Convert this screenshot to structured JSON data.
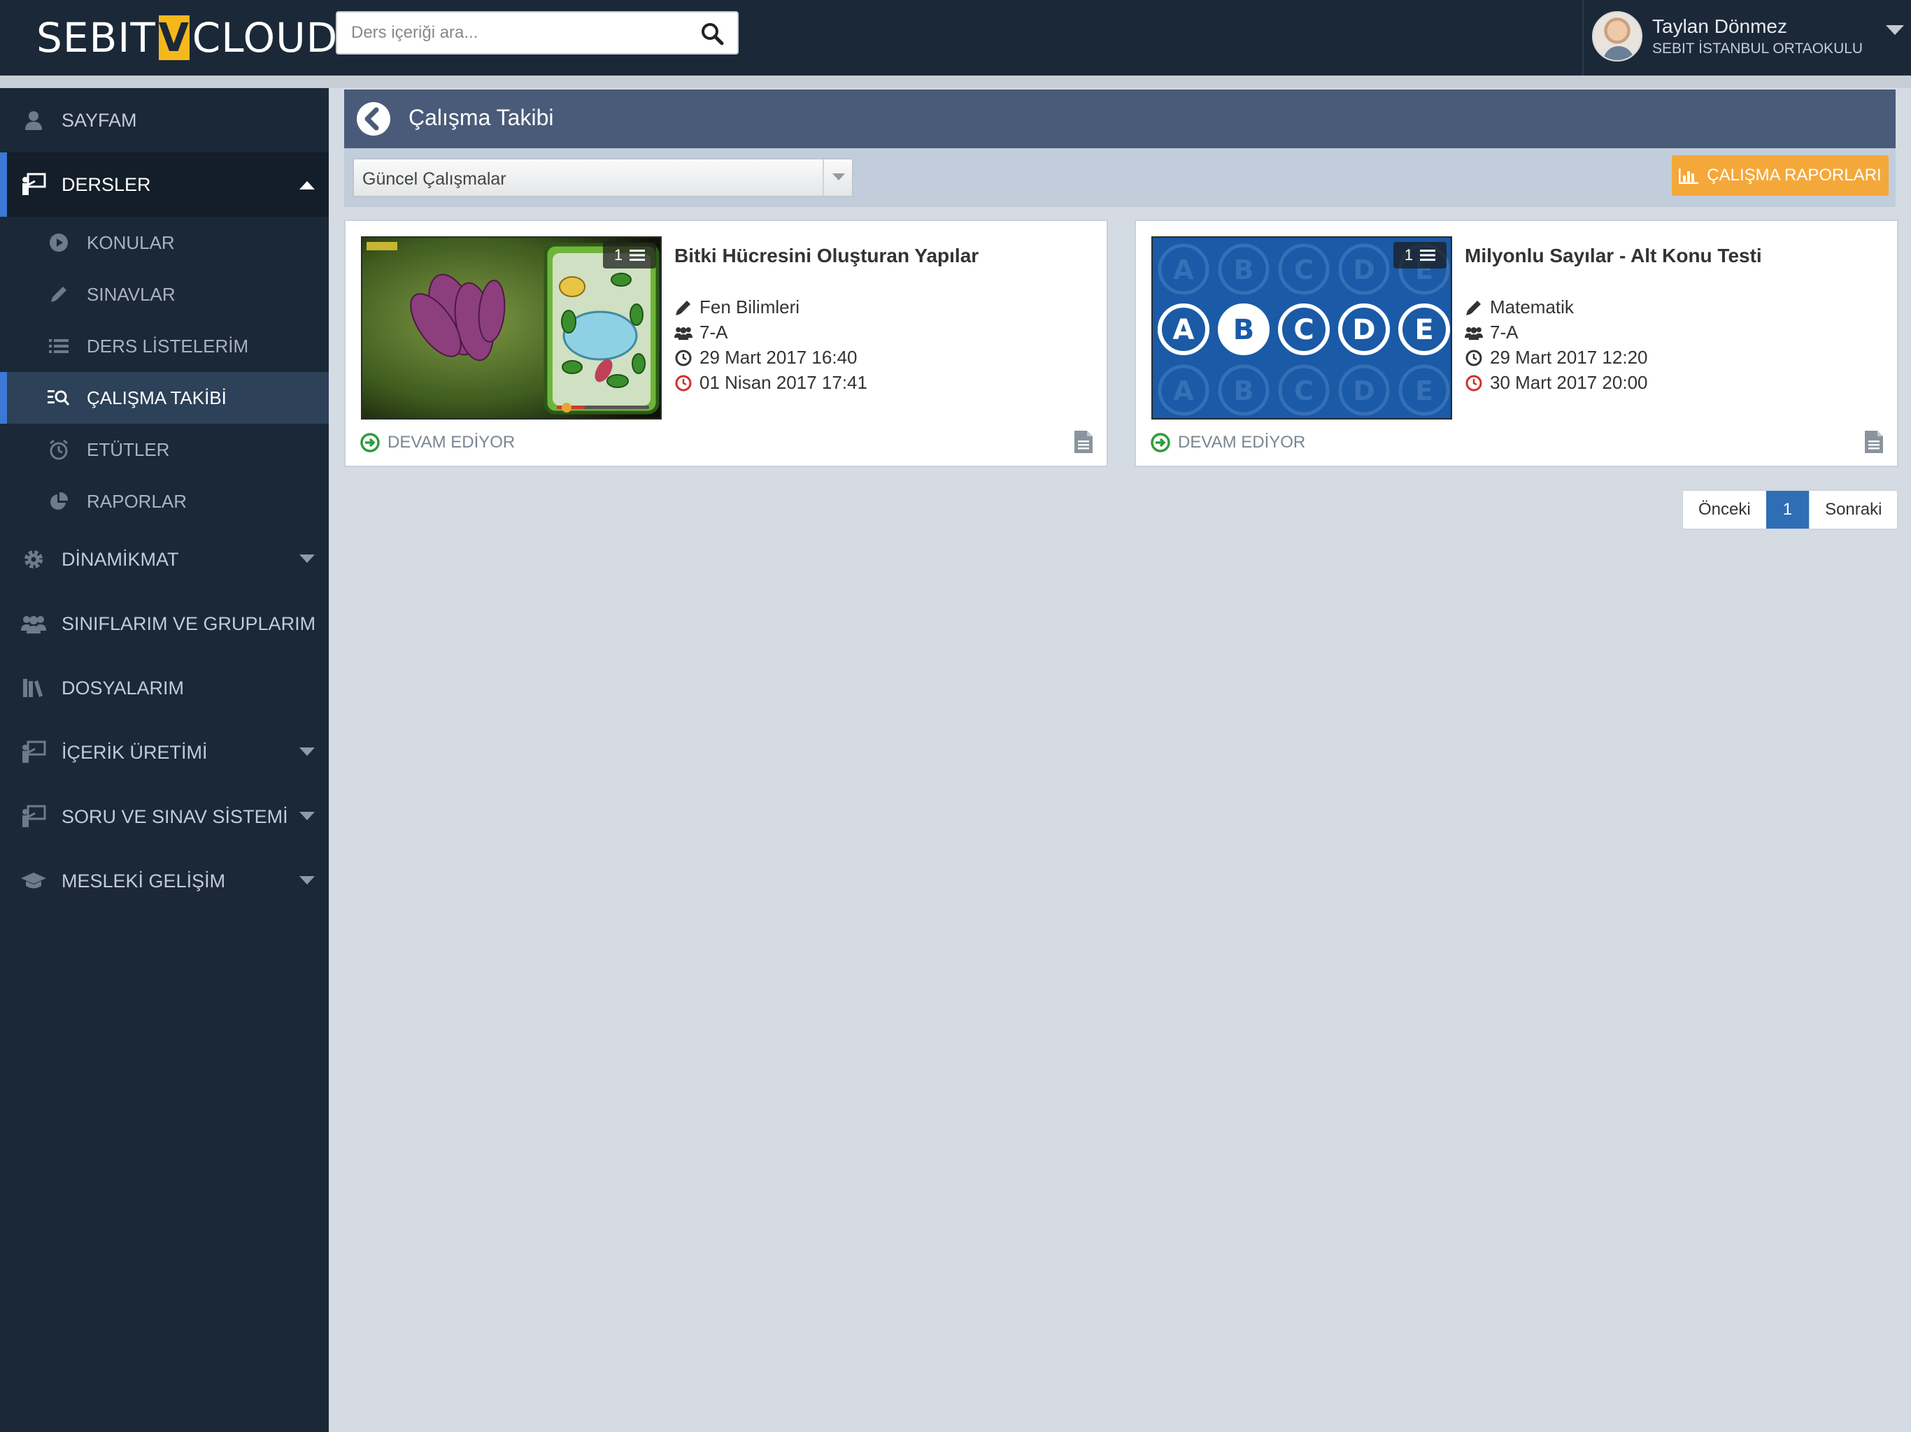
{
  "header": {
    "logo_left": "SEBIT",
    "logo_mark": "V",
    "logo_right": "CLOUD",
    "search_placeholder": "Ders içeriği ara...",
    "user_name": "Taylan Dönmez",
    "user_school": "SEBIT İSTANBUL ORTAOKULU"
  },
  "sidebar": {
    "items": [
      {
        "label": "SAYFAM",
        "icon": "user-icon"
      },
      {
        "label": "DERSLER",
        "icon": "teacher-board-icon"
      },
      {
        "label": "DİNAMİKMAT",
        "icon": "gear-icon"
      },
      {
        "label": "SINIFLARIM VE GRUPLARIM",
        "icon": "users-icon"
      },
      {
        "label": "DOSYALARIM",
        "icon": "library-icon"
      },
      {
        "label": "İÇERİK ÜRETİMİ",
        "icon": "teacher-board-icon"
      },
      {
        "label": "SORU VE SINAV SİSTEMİ",
        "icon": "teacher-board-icon"
      },
      {
        "label": "MESLEKİ GELİŞİM",
        "icon": "graduation-cap-icon"
      }
    ],
    "subitems": [
      {
        "label": "KONULAR",
        "icon": "play-circle-icon"
      },
      {
        "label": "SINAVLAR",
        "icon": "pencil-icon"
      },
      {
        "label": "DERS LİSTELERİM",
        "icon": "list-icon"
      },
      {
        "label": "ÇALIŞMA TAKİBİ",
        "icon": "search-list-icon"
      },
      {
        "label": "ETÜTLER",
        "icon": "alarm-clock-icon"
      },
      {
        "label": "RAPORLAR",
        "icon": "pie-chart-icon"
      }
    ]
  },
  "main": {
    "title": "Çalışma Takibi",
    "filter_value": "Güncel Çalışmalar",
    "reports_button": "ÇALIŞMA RAPORLARI",
    "cards": [
      {
        "title": "Bitki Hücresini Oluşturan Yapılar",
        "count": "1",
        "subject": "Fen Bilimleri",
        "class": "7-A",
        "start": "29 Mart 2017 16:40",
        "end": "01 Nisan 2017 17:41",
        "status": "DEVAM EDİYOR"
      },
      {
        "title": "Milyonlu Sayılar - Alt Konu Testi",
        "count": "1",
        "subject": "Matematik",
        "class": "7-A",
        "start": "29 Mart 2017 12:20",
        "end": "30 Mart 2017 20:00",
        "status": "DEVAM EDİYOR"
      }
    ],
    "pagination": {
      "prev": "Önceki",
      "current": "1",
      "next": "Sonraki"
    }
  },
  "colors": {
    "header_bg": "#1b2838",
    "accent_blue": "#3b78d8",
    "panel_header": "#4a5b79",
    "reports_orange": "#f5a83a",
    "status_green": "#2e9c3a",
    "end_date_red": "#d0302a"
  }
}
